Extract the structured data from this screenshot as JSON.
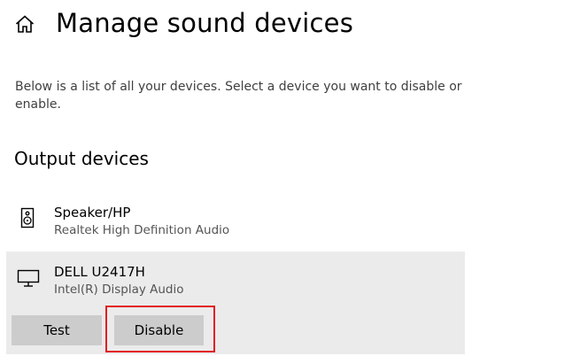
{
  "header": {
    "title": "Manage sound devices",
    "home_icon": "home-icon"
  },
  "description": "Below is a list of all your devices. Select a device you want to disable or enable.",
  "output_section": {
    "title": "Output devices",
    "devices": [
      {
        "name": "Speaker/HP",
        "subtitle": "Realtek High Definition Audio",
        "icon": "speaker-icon",
        "selected": false
      },
      {
        "name": "DELL U2417H",
        "subtitle": "Intel(R) Display Audio",
        "icon": "monitor-icon",
        "selected": true,
        "buttons": {
          "test_label": "Test",
          "disable_label": "Disable"
        }
      }
    ]
  },
  "colors": {
    "selected_bg": "#ebebeb",
    "button_bg": "#cccccc",
    "highlight_border": "#e31b23"
  }
}
